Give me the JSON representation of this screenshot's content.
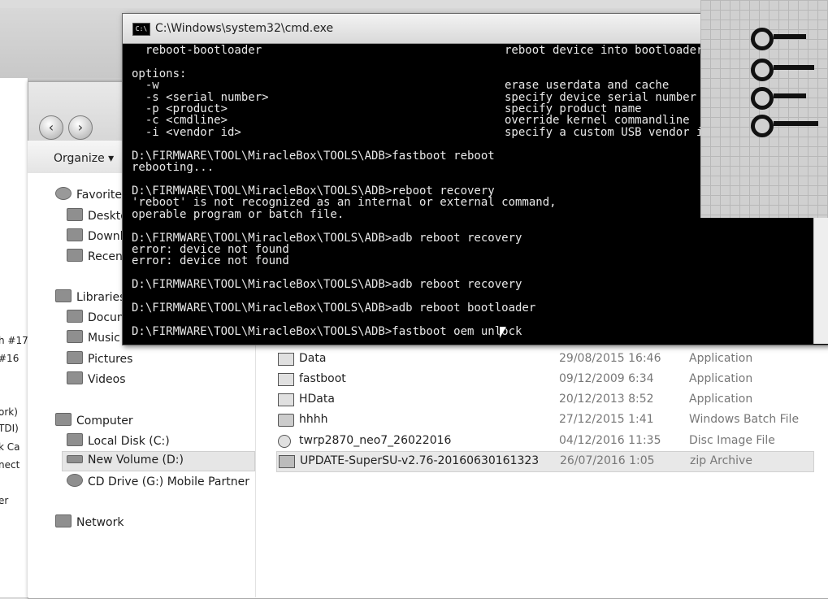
{
  "left_partial_labels": [
    "h #17",
    "#16",
    "ork)",
    "TDI)",
    "k Ca",
    "nect",
    "er"
  ],
  "explorer": {
    "toolbar_organize": "Organize ▾",
    "nav": {
      "favorites": "Favorites",
      "desktop": "Desktop",
      "downloads": "Downloads",
      "recent": "Recent Places",
      "libraries": "Libraries",
      "documents": "Documents",
      "music": "Music",
      "pictures": "Pictures",
      "videos": "Videos",
      "computer": "Computer",
      "local_disk": "Local Disk (C:)",
      "new_volume": "New Volume (D:)",
      "cd_drive": "CD Drive (G:) Mobile Partner",
      "network": "Network"
    },
    "files": [
      {
        "name": "Data",
        "date": "29/08/2015 16:46",
        "type": "Application"
      },
      {
        "name": "fastboot",
        "date": "09/12/2009 6:34",
        "type": "Application"
      },
      {
        "name": "HData",
        "date": "20/12/2013 8:52",
        "type": "Application"
      },
      {
        "name": "hhhh",
        "date": "27/12/2015 1:41",
        "type": "Windows Batch File"
      },
      {
        "name": "twrp2870_neo7_26022016",
        "date": "04/12/2016 11:35",
        "type": "Disc Image File"
      },
      {
        "name": "UPDATE-SuperSU-v2.76-20160630161323",
        "date": "26/07/2016 1:05",
        "type": "zip Archive"
      }
    ]
  },
  "cmd": {
    "title": "C:\\Windows\\system32\\cmd.exe",
    "lines": [
      "  reboot-bootloader",
      "",
      "options:",
      "  -w",
      "  -s <serial number>",
      "  -p <product>",
      "  -c <cmdline>",
      "  -i <vendor id>",
      "",
      "D:\\FIRMWARE\\TOOL\\MiracleBox\\TOOLS\\ADB>fastboot reboot",
      "rebooting...",
      "",
      "D:\\FIRMWARE\\TOOL\\MiracleBox\\TOOLS\\ADB>reboot recovery",
      "'reboot' is not recognized as an internal or external command,",
      "operable program or batch file.",
      "",
      "D:\\FIRMWARE\\TOOL\\MiracleBox\\TOOLS\\ADB>adb reboot recovery",
      "error: device not found",
      "error: device not found",
      "",
      "D:\\FIRMWARE\\TOOL\\MiracleBox\\TOOLS\\ADB>adb reboot recovery",
      "",
      "D:\\FIRMWARE\\TOOL\\MiracleBox\\TOOLS\\ADB>adb reboot bootloader",
      "",
      "D:\\FIRMWARE\\TOOL\\MiracleBox\\TOOLS\\ADB>fastboot oem unlock"
    ],
    "descriptions": [
      "reboot device into bootloader",
      "",
      "",
      "erase userdata and cache",
      "specify device serial number",
      "specify product name",
      "override kernel commandline",
      "specify a custom USB vendor id"
    ]
  }
}
